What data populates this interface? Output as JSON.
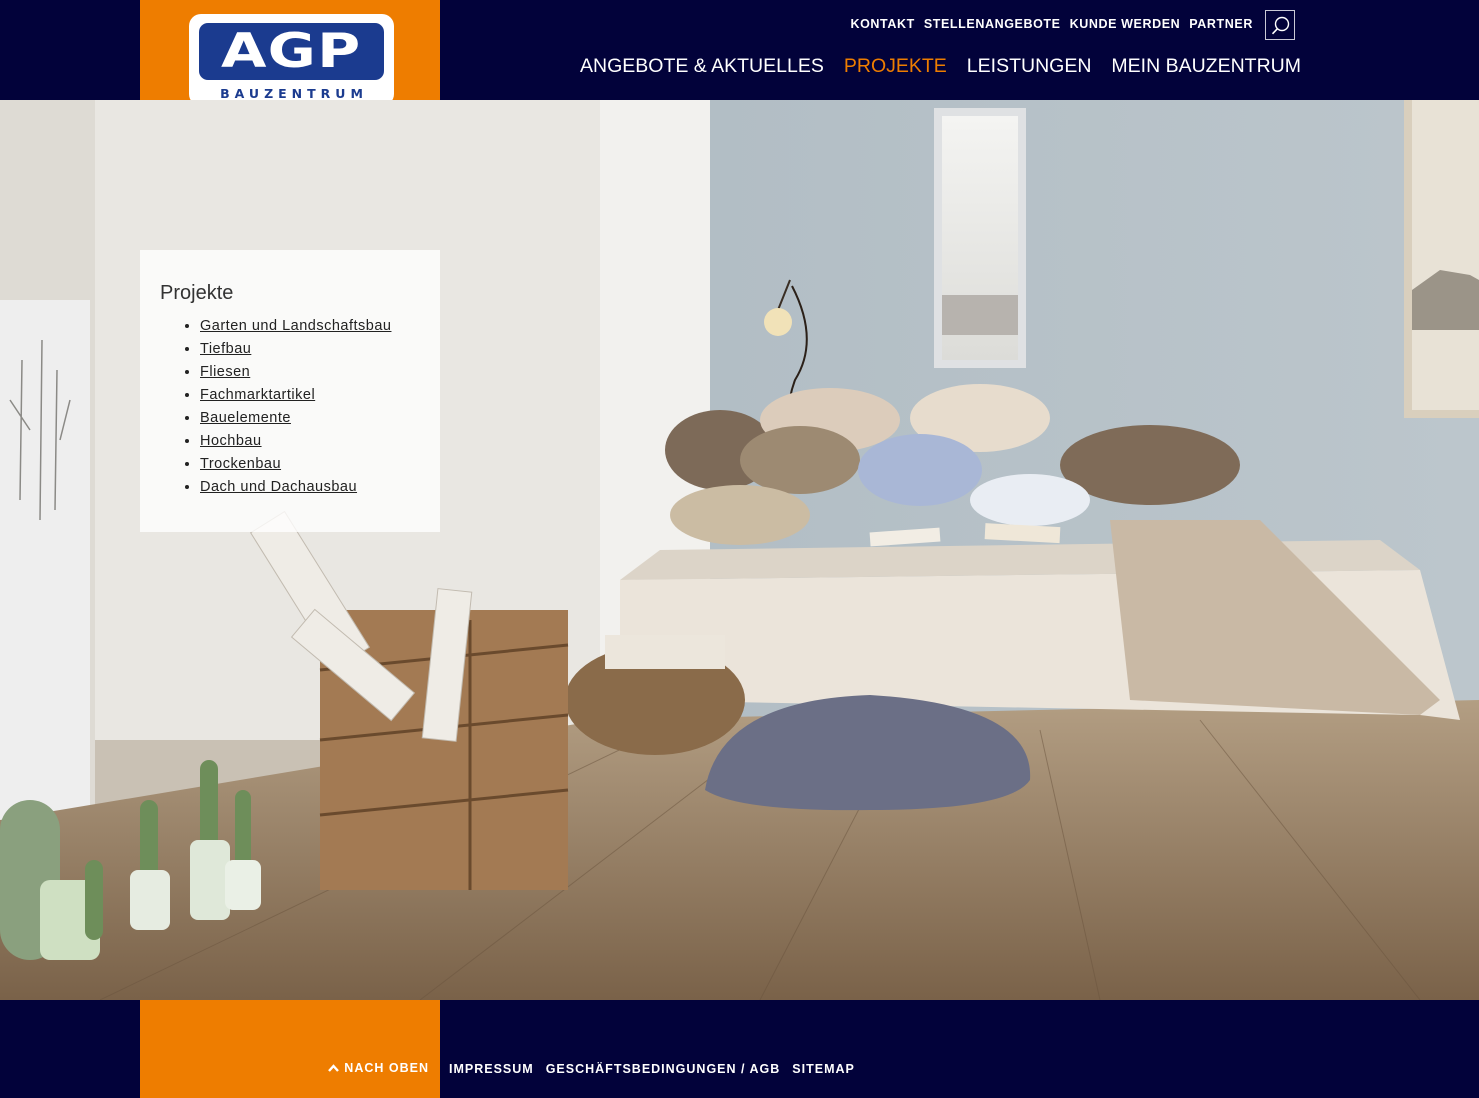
{
  "brand": {
    "logo_letters": "AGP",
    "logo_sub": "BAUZENTRUM",
    "colors": {
      "navy": "#02023a",
      "orange": "#ee7d00",
      "logo_blue": "#1b3b8f"
    }
  },
  "util_nav": [
    "KONTAKT",
    "STELLENANGEBOTE",
    "KUNDE WERDEN",
    "PARTNER"
  ],
  "search": {
    "icon": "search-icon"
  },
  "main_nav": [
    {
      "label": "ANGEBOTE & AKTUELLES",
      "active": false
    },
    {
      "label": "PROJEKTE",
      "active": true
    },
    {
      "label": "LEISTUNGEN",
      "active": false
    },
    {
      "label": "MEIN BAUZENTRUM",
      "active": false
    }
  ],
  "side_panel": {
    "title": "Projekte",
    "items": [
      "Garten und Landschaftsbau",
      "Tiefbau",
      "Fliesen",
      "Fachmarktartikel",
      "Bauelemente",
      "Hochbau",
      "Trockenbau",
      "Dach und Dachausbau"
    ]
  },
  "footer": {
    "to_top": "NACH OBEN",
    "links": [
      "IMPRESSUM",
      "GESCHÄFTSBEDINGUNGEN / AGB",
      "SITEMAP"
    ]
  }
}
